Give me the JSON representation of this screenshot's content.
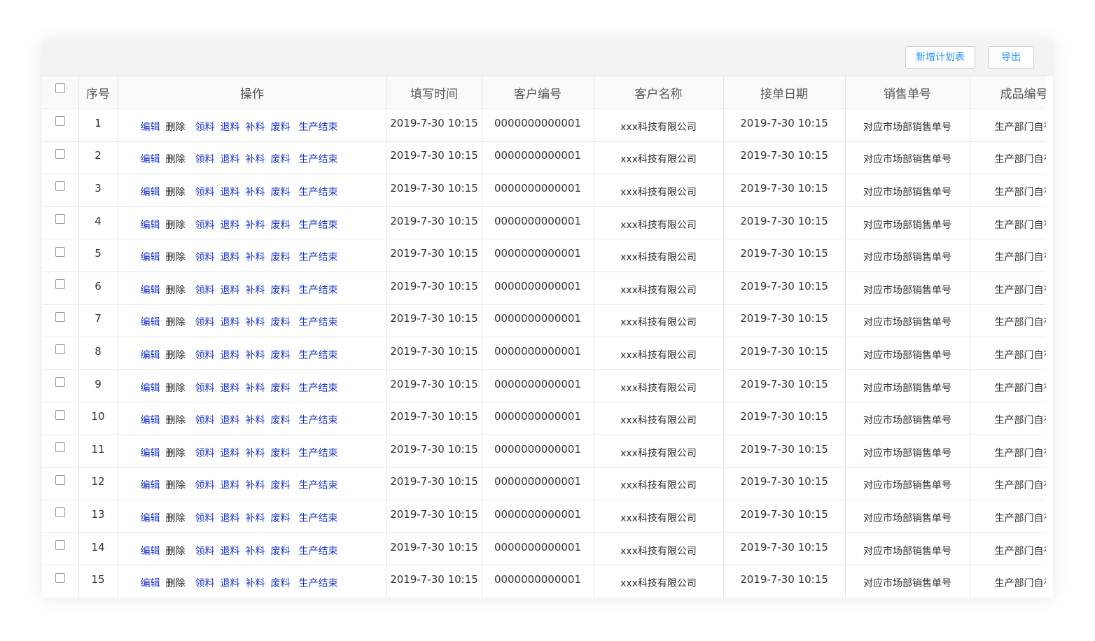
{
  "toolbar": {
    "new_plan_label": "新增计划表",
    "export_label": "导出"
  },
  "columns": [
    "序号",
    "操作",
    "填写时间",
    "客户编号",
    "客户名称",
    "接单日期",
    "销售单号",
    "成品编号"
  ],
  "actions": [
    "编辑",
    "删除",
    "领料",
    "退料",
    "补料",
    "废料",
    "生产结束"
  ],
  "rows": [
    {
      "no": "1",
      "fill_time": "2019-7-30 10:15",
      "customer_no": "0000000000001",
      "customer_name": "xxx科技有限公司",
      "order_date": "2019-7-30 10:15",
      "sales_no": "对应市场部销售单号",
      "product_no": "生产部门自有"
    },
    {
      "no": "2",
      "fill_time": "2019-7-30 10:15",
      "customer_no": "0000000000001",
      "customer_name": "xxx科技有限公司",
      "order_date": "2019-7-30 10:15",
      "sales_no": "对应市场部销售单号",
      "product_no": "生产部门自有"
    },
    {
      "no": "3",
      "fill_time": "2019-7-30 10:15",
      "customer_no": "0000000000001",
      "customer_name": "xxx科技有限公司",
      "order_date": "2019-7-30 10:15",
      "sales_no": "对应市场部销售单号",
      "product_no": "生产部门自有"
    },
    {
      "no": "4",
      "fill_time": "2019-7-30 10:15",
      "customer_no": "0000000000001",
      "customer_name": "xxx科技有限公司",
      "order_date": "2019-7-30 10:15",
      "sales_no": "对应市场部销售单号",
      "product_no": "生产部门自有"
    },
    {
      "no": "5",
      "fill_time": "2019-7-30 10:15",
      "customer_no": "0000000000001",
      "customer_name": "xxx科技有限公司",
      "order_date": "2019-7-30 10:15",
      "sales_no": "对应市场部销售单号",
      "product_no": "生产部门自有"
    },
    {
      "no": "6",
      "fill_time": "2019-7-30 10:15",
      "customer_no": "0000000000001",
      "customer_name": "xxx科技有限公司",
      "order_date": "2019-7-30 10:15",
      "sales_no": "对应市场部销售单号",
      "product_no": "生产部门自有"
    },
    {
      "no": "7",
      "fill_time": "2019-7-30 10:15",
      "customer_no": "0000000000001",
      "customer_name": "xxx科技有限公司",
      "order_date": "2019-7-30 10:15",
      "sales_no": "对应市场部销售单号",
      "product_no": "生产部门自有"
    },
    {
      "no": "8",
      "fill_time": "2019-7-30 10:15",
      "customer_no": "0000000000001",
      "customer_name": "xxx科技有限公司",
      "order_date": "2019-7-30 10:15",
      "sales_no": "对应市场部销售单号",
      "product_no": "生产部门自有"
    },
    {
      "no": "9",
      "fill_time": "2019-7-30 10:15",
      "customer_no": "0000000000001",
      "customer_name": "xxx科技有限公司",
      "order_date": "2019-7-30 10:15",
      "sales_no": "对应市场部销售单号",
      "product_no": "生产部门自有"
    },
    {
      "no": "10",
      "fill_time": "2019-7-30 10:15",
      "customer_no": "0000000000001",
      "customer_name": "xxx科技有限公司",
      "order_date": "2019-7-30 10:15",
      "sales_no": "对应市场部销售单号",
      "product_no": "生产部门自有"
    },
    {
      "no": "11",
      "fill_time": "2019-7-30 10:15",
      "customer_no": "0000000000001",
      "customer_name": "xxx科技有限公司",
      "order_date": "2019-7-30 10:15",
      "sales_no": "对应市场部销售单号",
      "product_no": "生产部门自有"
    },
    {
      "no": "12",
      "fill_time": "2019-7-30 10:15",
      "customer_no": "0000000000001",
      "customer_name": "xxx科技有限公司",
      "order_date": "2019-7-30 10:15",
      "sales_no": "对应市场部销售单号",
      "product_no": "生产部门自有"
    },
    {
      "no": "13",
      "fill_time": "2019-7-30 10:15",
      "customer_no": "0000000000001",
      "customer_name": "xxx科技有限公司",
      "order_date": "2019-7-30 10:15",
      "sales_no": "对应市场部销售单号",
      "product_no": "生产部门自有"
    },
    {
      "no": "14",
      "fill_time": "2019-7-30 10:15",
      "customer_no": "0000000000001",
      "customer_name": "xxx科技有限公司",
      "order_date": "2019-7-30 10:15",
      "sales_no": "对应市场部销售单号",
      "product_no": "生产部门自有"
    },
    {
      "no": "15",
      "fill_time": "2019-7-30 10:15",
      "customer_no": "0000000000001",
      "customer_name": "xxx科技有限公司",
      "order_date": "2019-7-30 10:15",
      "sales_no": "对应市场部销售单号",
      "product_no": "生产部门自有"
    }
  ],
  "colors": {
    "link_blue": "#1a35cc",
    "button_blue": "#1e90ff",
    "border": "#e6e6e6"
  }
}
